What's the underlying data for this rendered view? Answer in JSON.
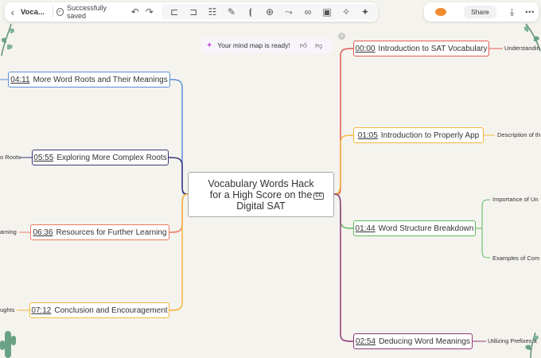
{
  "toolbar": {
    "doc_title": "Voca...",
    "save_status": "Successfully saved",
    "share_label": "Share"
  },
  "banner": {
    "text": "Your mind map is ready!"
  },
  "central": {
    "lines": [
      "Vocabulary Words Hack",
      "for a High Score on the",
      "Digital SAT"
    ],
    "cc_label": "CC"
  },
  "left_nodes": [
    {
      "time": "04:11",
      "title": "More Word Roots and Their Meanings",
      "color": "#5b8fd9"
    },
    {
      "time": "05:55",
      "title": "Exploring More Complex Roots",
      "color": "#3a3578"
    },
    {
      "time": "06:36",
      "title": "Resources for Further Learning",
      "color": "#ef7a63"
    },
    {
      "time": "07:12",
      "title": "Conclusion and Encouragement",
      "color": "#f5b73b"
    }
  ],
  "right_nodes": [
    {
      "time": "00:00",
      "title": "Introduction to SAT Vocabulary",
      "color": "#e25b52"
    },
    {
      "time": "01:05",
      "title": "Introduction to Properly App",
      "color": "#f5b73b"
    },
    {
      "time": "01:44",
      "title": "Word Structure Breakdown",
      "color": "#5cb85c"
    },
    {
      "time": "02:54",
      "title": "Deducing Word Meanings",
      "color": "#8e3a7a"
    }
  ],
  "leaves": {
    "left_roots": "o Roots",
    "left_learning": "arning",
    "left_thoughts": "ughts",
    "right_understanding": "Understandin",
    "right_description": "Description of th",
    "right_importance": "Importance of Un",
    "right_examples": "Examples of Com",
    "right_prefixes": "Utilizing Prefixes a"
  }
}
